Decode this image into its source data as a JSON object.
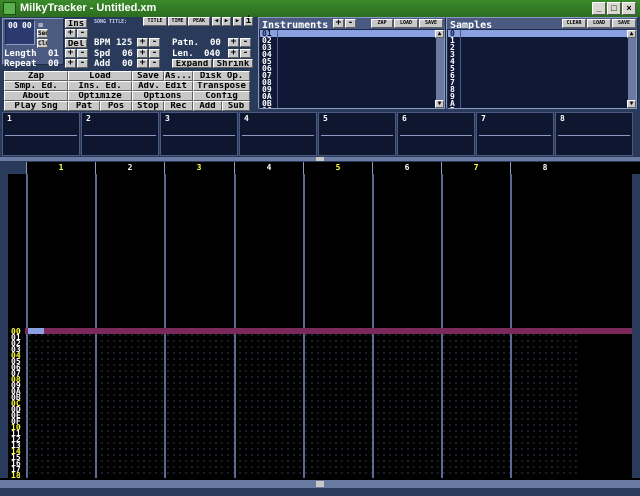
{
  "window": {
    "title": "MilkyTracker - Untitled.xm",
    "buttons": {
      "minimize": "_",
      "maximize": "□",
      "close": "×"
    }
  },
  "order": {
    "position": "00",
    "pattern": "00",
    "seq_label": "Seq",
    "cln_label": "Cln",
    "ins_label": "Ins",
    "del_label": "Del",
    "length_label": "Length",
    "length_value": "01",
    "repeat_label": "Repeat",
    "repeat_value": "00"
  },
  "song": {
    "title_label": "SONG TITLE:",
    "title_btn": "TITLE",
    "time_btn": "TIME",
    "peak_btn": "PEAK",
    "bpm_label": "BPM",
    "bpm_value": "125",
    "spd_label": "Spd",
    "spd_value": "06",
    "add_label": "Add",
    "add_value": "00",
    "patn_label": "Patn.",
    "patn_value": "00",
    "len_label": "Len.",
    "len_value": "040",
    "expand": "Expand",
    "shrink": "Shrink",
    "plus": "+",
    "minus": "-"
  },
  "main_buttons": [
    [
      "Zap",
      "Load",
      "Save",
      "As...",
      "Disk Op."
    ],
    [
      "Smp. Ed.",
      "Ins. Ed.",
      "Adv. Edit",
      "Transpose"
    ],
    [
      "About",
      "Optimize",
      "Options",
      "Config"
    ],
    [
      "Play Sng",
      "Pat",
      "Pos",
      "Stop",
      "Rec",
      "Add",
      "Sub"
    ]
  ],
  "instruments": {
    "title": "Instruments",
    "zap": "ZAP",
    "load": "LOAD",
    "save": "SAVE",
    "items": [
      "01",
      "02",
      "03",
      "04",
      "05",
      "06",
      "07",
      "08",
      "09",
      "0A",
      "0B",
      "0C"
    ]
  },
  "samples": {
    "title": "Samples",
    "clear": "CLEAR",
    "load": "LOAD",
    "save": "SAVE",
    "items": [
      "0",
      "1",
      "2",
      "3",
      "4",
      "5",
      "6",
      "7",
      "8",
      "9",
      "A",
      "B"
    ]
  },
  "scopes": [
    "1",
    "2",
    "3",
    "4",
    "5",
    "6",
    "7",
    "8"
  ],
  "pattern": {
    "channels": [
      "1",
      "2",
      "3",
      "4",
      "5",
      "6",
      "7",
      "8"
    ],
    "rows": [
      "00",
      "01",
      "02",
      "03",
      "04",
      "05",
      "06",
      "07",
      "08",
      "09",
      "0A",
      "0B",
      "0C",
      "0D",
      "0E",
      "0F",
      "10",
      "11",
      "12",
      "13",
      "14",
      "15",
      "16",
      "17",
      "18"
    ],
    "highlight_color": "#ffff40",
    "normal_color": "#ffffff"
  }
}
